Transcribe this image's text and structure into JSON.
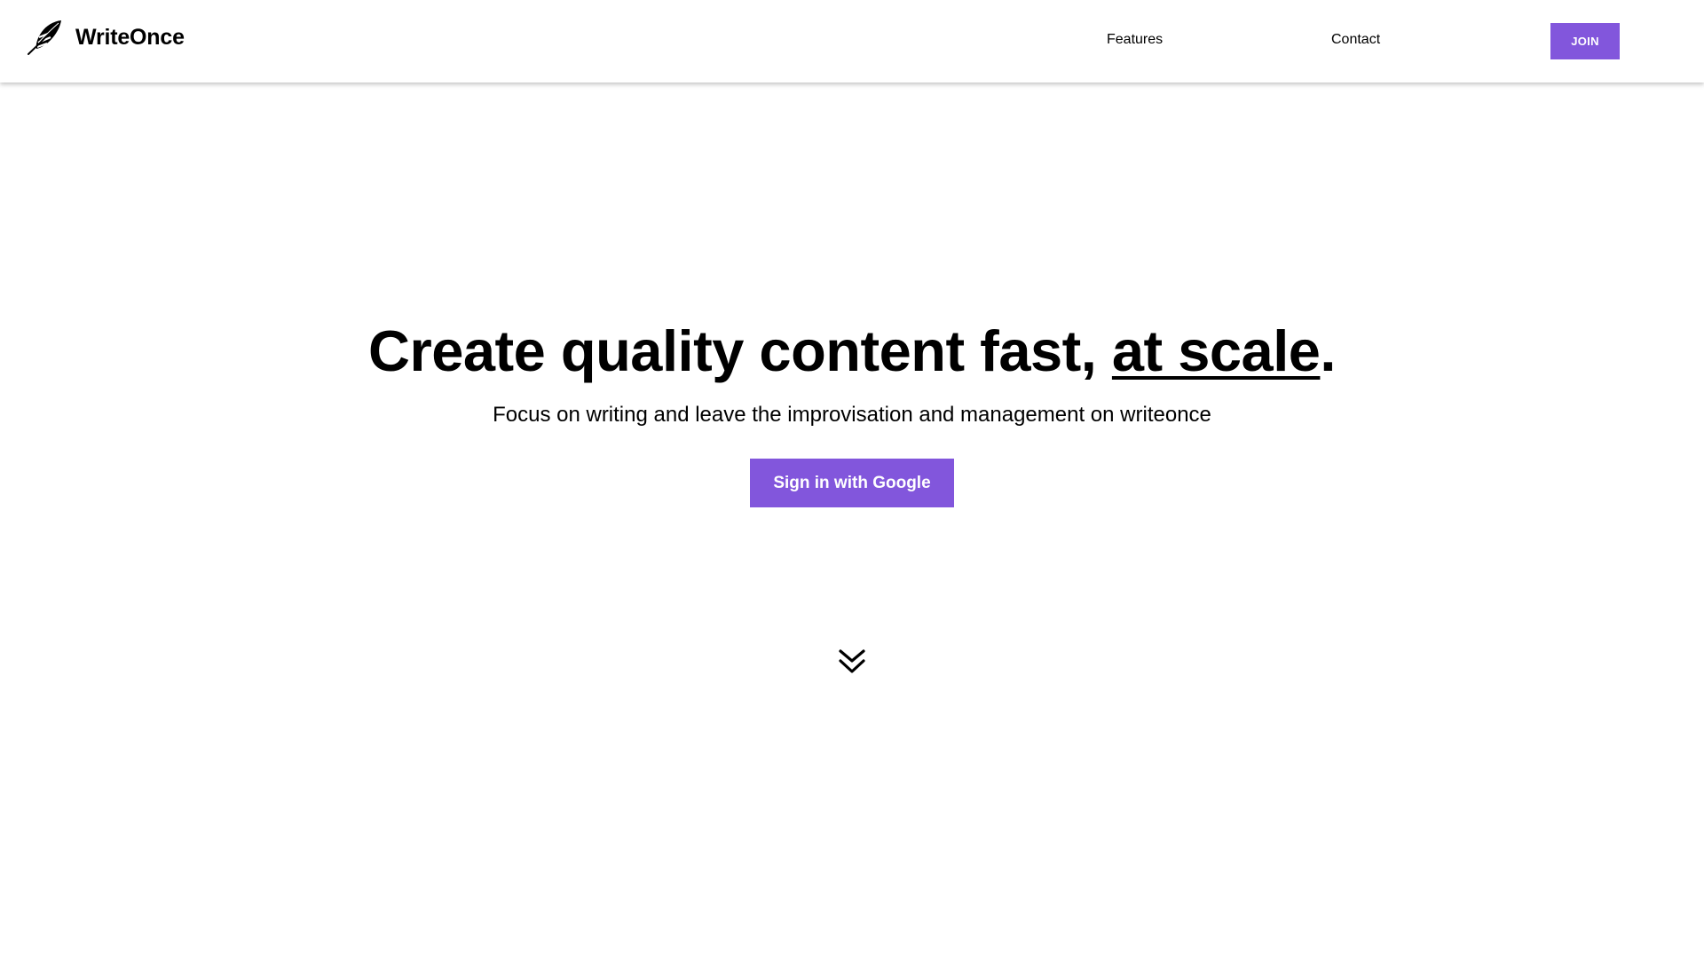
{
  "header": {
    "brand_name": "WriteOnce",
    "logo_icon": "feather-icon",
    "nav": {
      "features_label": "Features",
      "contact_label": "Contact"
    },
    "join_label": "JOIN"
  },
  "hero": {
    "title_part1": "Create quality content fast, ",
    "title_emphasis": "at scale",
    "title_end": ".",
    "subtitle": "Focus on writing and leave the improvisation and management on writeonce",
    "cta_label": "Sign in with Google",
    "scroll_icon": "double-chevron-down-icon"
  },
  "colors": {
    "accent": "#8256dc",
    "background": "#ffffff",
    "text": "#000000"
  }
}
